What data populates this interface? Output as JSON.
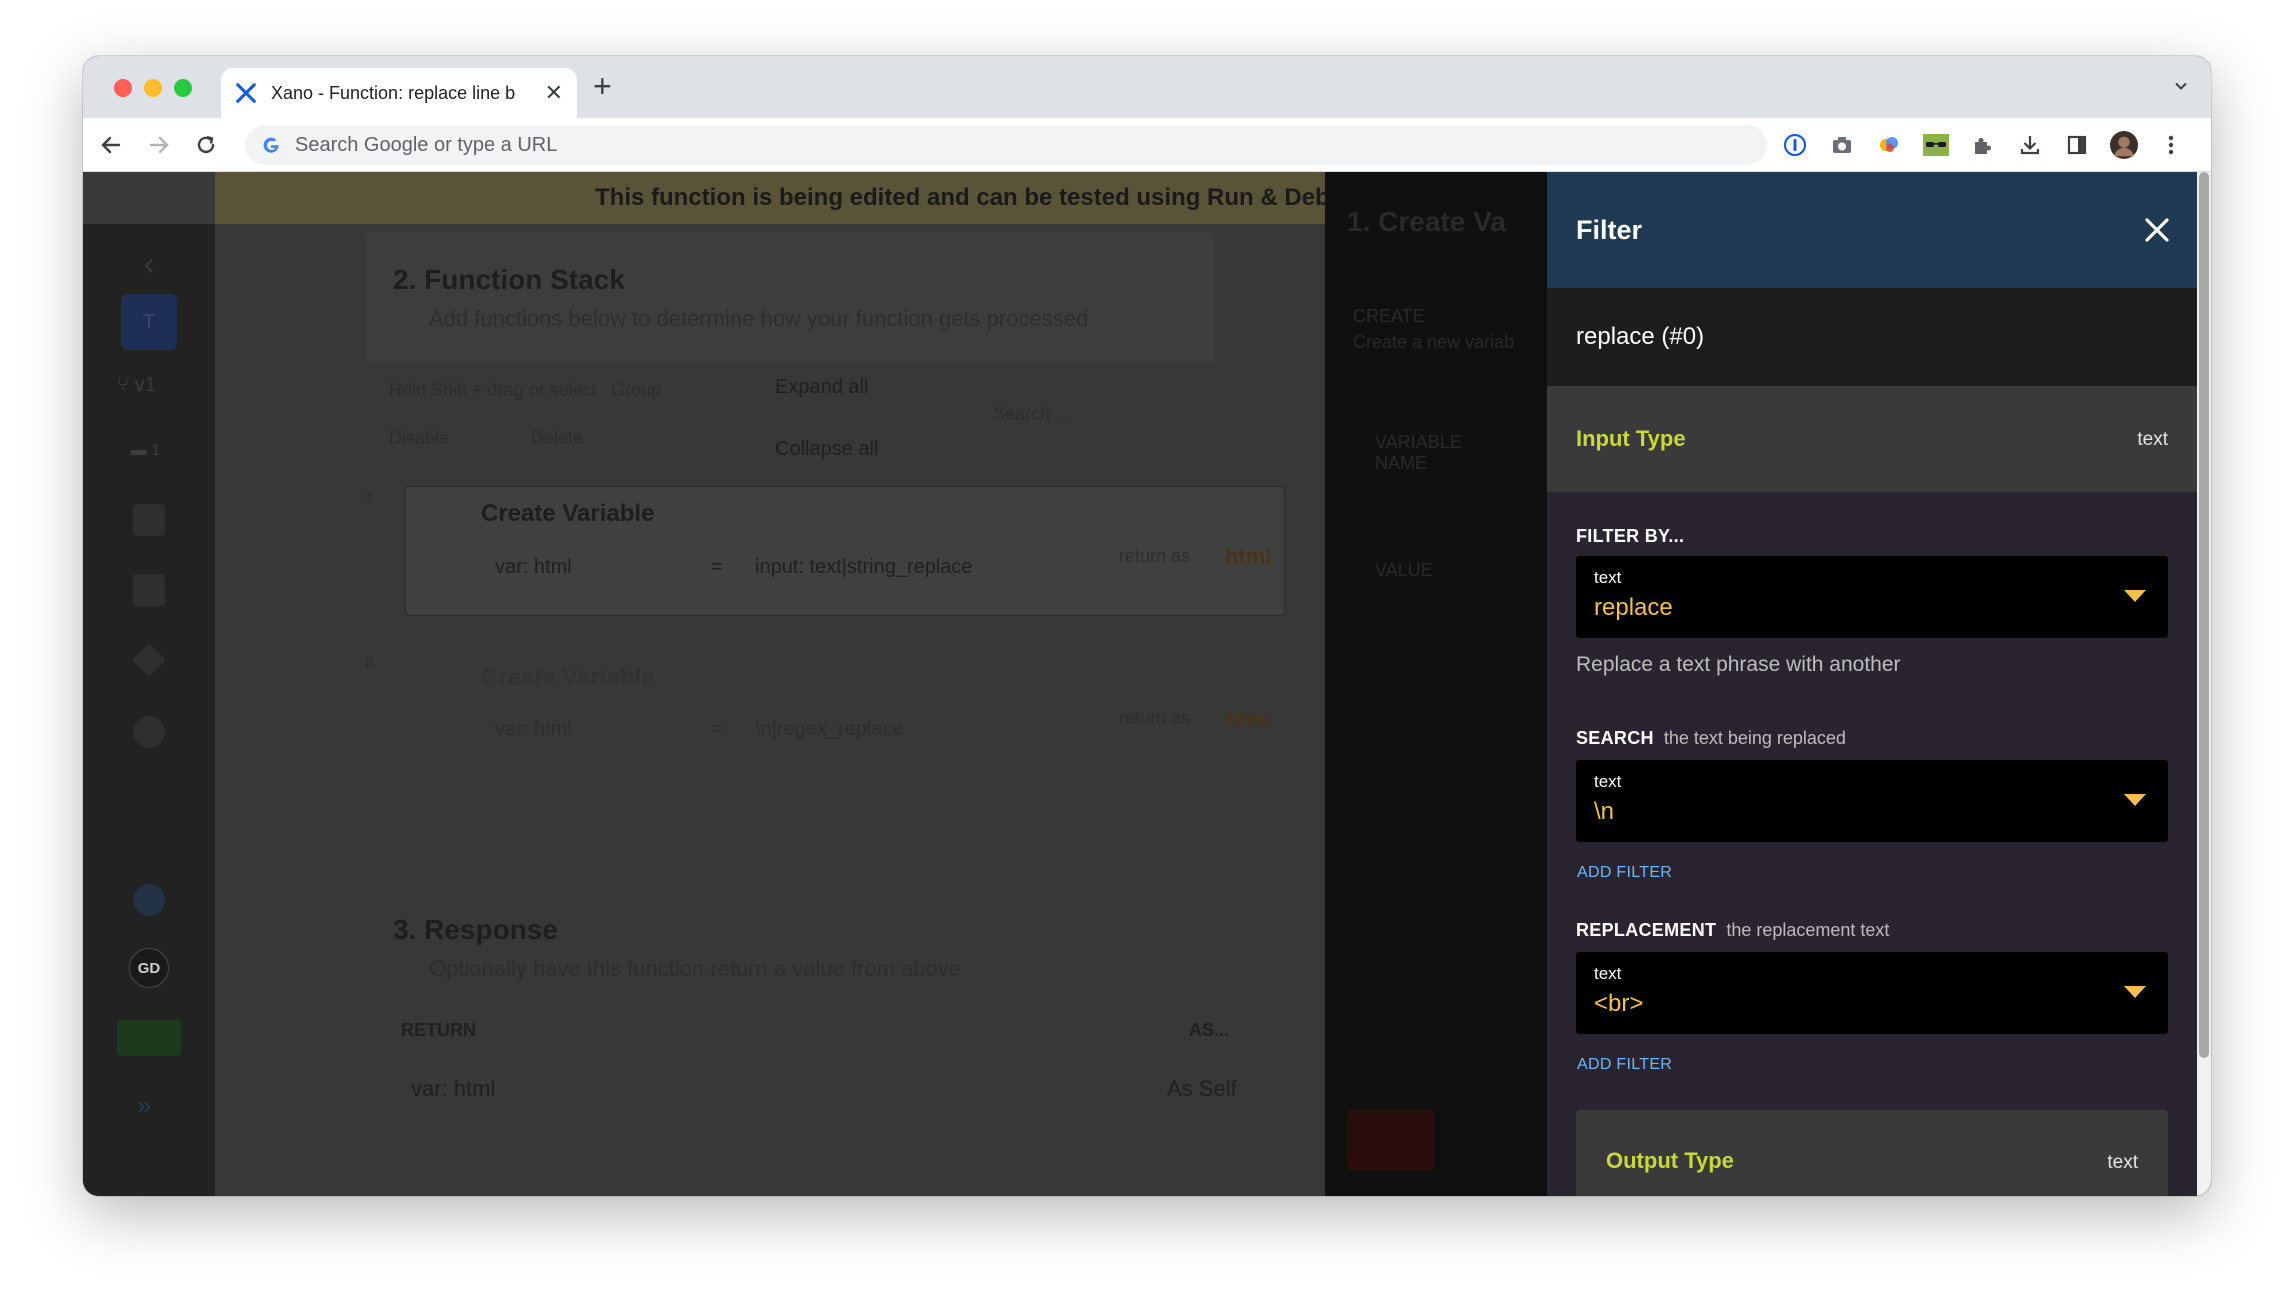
{
  "browser": {
    "tab_title": "Xano - Function: replace line b",
    "omnibox_placeholder": "Search Google or type a URL"
  },
  "background": {
    "banner": "This function is being edited and can be tested using Run & Debug. Clic",
    "version": "v1",
    "count": "1",
    "workspace_initial": "T",
    "user_initials": "GD",
    "function_stack": {
      "title": "2. Function Stack",
      "subtitle": "Add functions below to determine how your function gets processed",
      "hold_hint": "Hold Shift + drag or select",
      "group": "Group",
      "disable": "Disable",
      "delete": "Delete",
      "expand_all": "Expand all",
      "collapse_all": "Collapse all",
      "search_placeholder": "Search ...",
      "steps": [
        {
          "num": "1",
          "title": "Create Variable",
          "var": "var: html",
          "eq": "=",
          "expr": "input: text|string_replace",
          "ret_prefix": "return as",
          "ret_name": "html"
        },
        {
          "num": "2",
          "title": "Create Variable",
          "var": "var: html",
          "eq": "=",
          "expr": "\\n|regex_replace",
          "ret_prefix": "return as",
          "ret_name": "html"
        }
      ]
    },
    "response": {
      "title": "3. Response",
      "subtitle": "Optionally have this function return a value from above",
      "return_label": "RETURN",
      "as_label": "AS...",
      "return_value": "var: html",
      "as_value": "As Self"
    },
    "middle": {
      "title": "1. Create Va",
      "create_label": "CREATE",
      "create_desc": "Create a new variab",
      "variable_name_label": "VARIABLE NAME",
      "value_label": "VALUE"
    }
  },
  "filter_panel": {
    "title": "Filter",
    "subtitle": "replace (#0)",
    "input_type_label": "Input Type",
    "input_type_value": "text",
    "filter_by_label": "FILTER BY...",
    "filter_select": {
      "type": "text",
      "value": "replace"
    },
    "filter_description": "Replace a text phrase with another",
    "search": {
      "label": "SEARCH",
      "hint": "the text being replaced",
      "type": "text",
      "value": "\\n",
      "add_filter": "ADD FILTER"
    },
    "replacement": {
      "label": "REPLACEMENT",
      "hint": "the replacement text",
      "type": "text",
      "value": "<br>",
      "add_filter": "ADD FILTER"
    },
    "output_type_label": "Output Type",
    "output_type_value": "text"
  },
  "colors": {
    "header_bg": "#1f3a52",
    "panel_bg": "#2a2431",
    "accent_yellow": "#c9d83b",
    "value_orange": "#f2c14e",
    "link_blue": "#6fb6ff"
  }
}
